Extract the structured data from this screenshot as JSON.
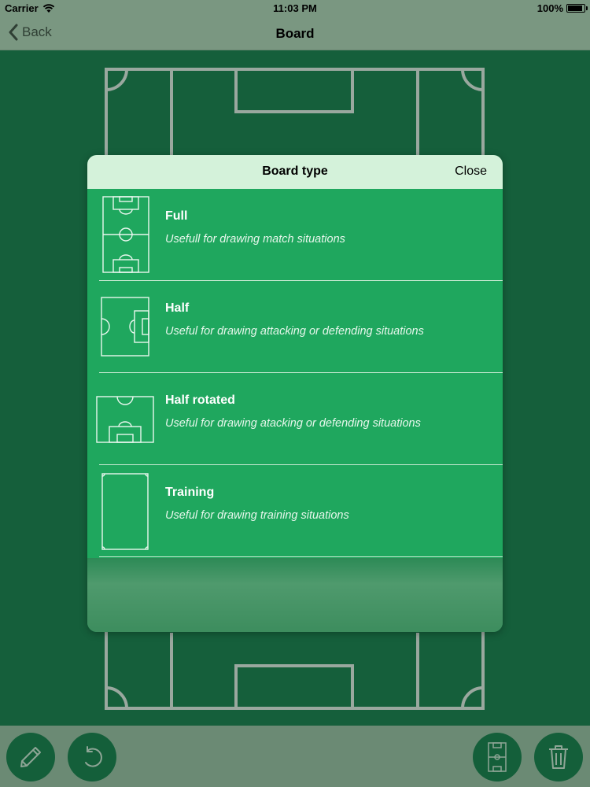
{
  "status_bar": {
    "carrier": "Carrier",
    "time": "11:03 PM",
    "battery": "100%",
    "battery_level": 1.0
  },
  "nav": {
    "back_label": "Back",
    "title": "Board"
  },
  "modal": {
    "title": "Board type",
    "close_label": "Close",
    "options": [
      {
        "label": "Full",
        "description": "Usefull for drawing match situations",
        "icon": "full-pitch-icon"
      },
      {
        "label": "Half",
        "description": "Useful for drawing attacking or defending situations",
        "icon": "half-pitch-icon"
      },
      {
        "label": "Half rotated",
        "description": "Useful for drawing atacking or defending situations",
        "icon": "half-rotated-pitch-icon"
      },
      {
        "label": "Training",
        "description": "Useful for drawing training situations",
        "icon": "training-pitch-icon"
      }
    ]
  },
  "toolbar": {
    "buttons": [
      "pencil-icon",
      "undo-icon",
      "board-type-icon",
      "trash-icon"
    ]
  },
  "colors": {
    "pitch": "#155f3b",
    "modal_body": "#1fa75e",
    "modal_header": "#d4f2da",
    "dimmed_bar": "#7a9781"
  }
}
